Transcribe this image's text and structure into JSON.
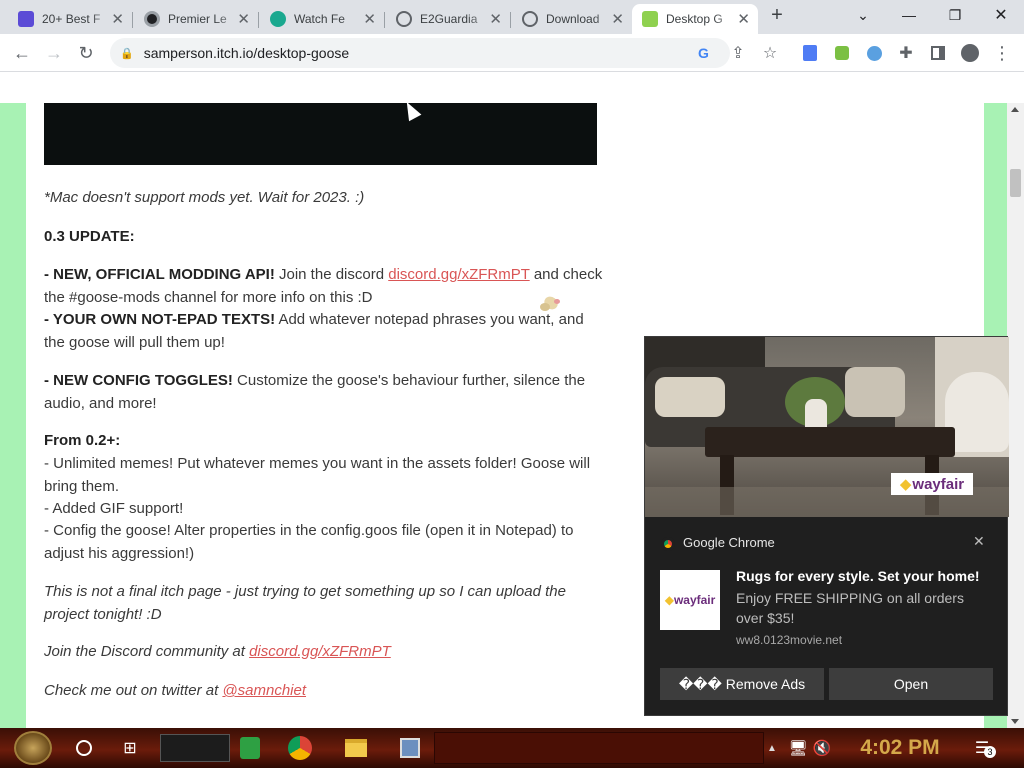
{
  "browser": {
    "tabs": [
      {
        "title": "20+ Best F",
        "favicon_color": "#5b4bd6"
      },
      {
        "title": "Premier Le",
        "favicon_color": "#202124"
      },
      {
        "title": "Watch Fe",
        "favicon_color": "#1aa88f"
      },
      {
        "title": "E2Guardia",
        "favicon_color": "#5f6368"
      },
      {
        "title": "Download",
        "favicon_color": "#5f6368"
      },
      {
        "title": "Desktop G",
        "favicon_color": "#8fd14f"
      }
    ],
    "url": "samperson.itch.io/desktop-goose"
  },
  "page": {
    "mac_note": "*Mac doesn't support mods yet. Wait for 2023. :)",
    "update_heading": "0.3 UPDATE:",
    "item1_bold": " - NEW, OFFICIAL MODDING API!",
    "item1_text_a": " Join the discord ",
    "item1_link": "discord.gg/xZFRmPT",
    "item1_text_b": " and check the #goose-mods channel for more info on this :D",
    "item2_bold": " - YOUR OWN NOT-EPAD TEXTS!",
    "item2_text": " Add whatever notepad phrases you want, and the goose will pull them up!",
    "item3_bold": " - NEW CONFIG TOGGLES!",
    "item3_text": " Customize the goose's behaviour further, silence the audio, and more!",
    "from_heading": "From 0.2+:",
    "from_line1": "- Unlimited memes! Put whatever memes you want in the assets folder! Goose will bring them.",
    "from_line2": "- Added GIF support!",
    "from_line3": "- Config the goose! Alter properties in the config.goos file (open it in Notepad) to adjust his aggression!)",
    "final_note": " This is not a final itch page - just trying to get something up so I can upload the project tonight! :D",
    "discord_prefix": "Join the Discord community at ",
    "discord_link": "discord.gg/xZFRmPT",
    "twitter_prefix": "Check me out on twitter at ",
    "twitter_link": "@samnchiet"
  },
  "notification": {
    "app": "Google Chrome",
    "title": "Rugs for every style. Set your home!",
    "body": "Enjoy FREE SHIPPING on all orders over $35!",
    "source": "ww8.0123movie.net",
    "brand": "wayfair",
    "btn_remove": "��� Remove Ads",
    "btn_open": "Open"
  },
  "taskbar": {
    "time": "4:02 PM",
    "notification_count": "3"
  }
}
